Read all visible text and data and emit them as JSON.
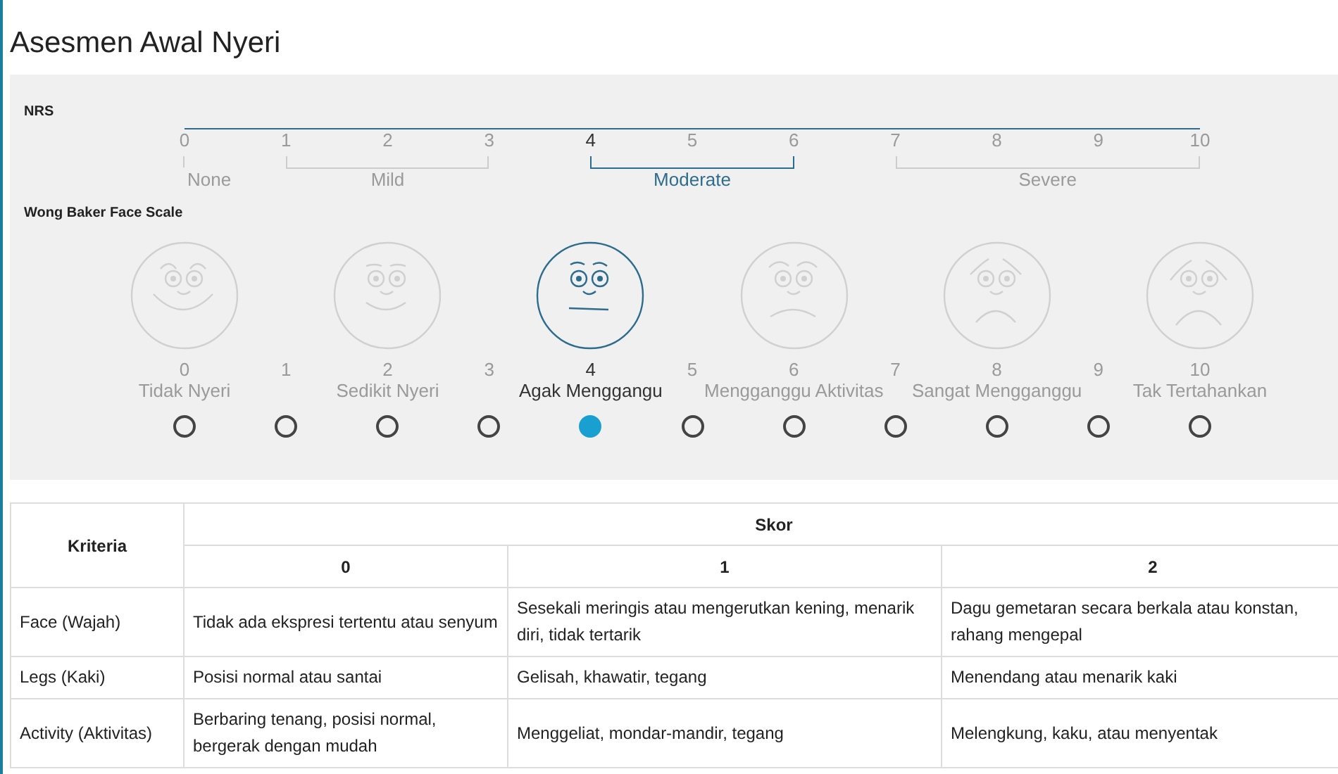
{
  "title": "Asesmen Awal Nyeri",
  "nrs": {
    "label": "NRS",
    "numbers": [
      {
        "label": "0",
        "selected": false
      },
      {
        "label": "1",
        "selected": false
      },
      {
        "label": "2",
        "selected": false
      },
      {
        "label": "3",
        "selected": false
      },
      {
        "label": "4",
        "selected": true
      },
      {
        "label": "5",
        "selected": false
      },
      {
        "label": "6",
        "selected": false
      },
      {
        "label": "7",
        "selected": false
      },
      {
        "label": "8",
        "selected": false
      },
      {
        "label": "9",
        "selected": false
      },
      {
        "label": "10",
        "selected": false
      }
    ],
    "categories": [
      {
        "label": "None",
        "selected": false
      },
      {
        "label": "Mild",
        "selected": false
      },
      {
        "label": "Moderate",
        "selected": true
      },
      {
        "label": "Severe",
        "selected": false
      }
    ]
  },
  "wong_baker": {
    "label": "Wong Baker Face Scale",
    "options": [
      {
        "kind": "face",
        "number": "0",
        "label": "Tidak Nyeri",
        "selected": false
      },
      {
        "kind": "plain",
        "number": "1",
        "selected": false
      },
      {
        "kind": "face",
        "number": "2",
        "label": "Sedikit Nyeri",
        "selected": false
      },
      {
        "kind": "plain",
        "number": "3",
        "selected": false
      },
      {
        "kind": "face",
        "number": "4",
        "label": "Agak Menggangu",
        "selected": true
      },
      {
        "kind": "plain",
        "number": "5",
        "selected": false
      },
      {
        "kind": "face",
        "number": "6",
        "label": "Mengganggu Aktivitas",
        "selected": false
      },
      {
        "kind": "plain",
        "number": "7",
        "selected": false
      },
      {
        "kind": "face",
        "number": "8",
        "label": "Sangat Mengganggu",
        "selected": false
      },
      {
        "kind": "plain",
        "number": "9",
        "selected": false
      },
      {
        "kind": "face",
        "number": "10",
        "label": "Tak Tertahankan",
        "selected": false
      }
    ]
  },
  "table": {
    "criteria_header": "Kriteria",
    "score_header": "Skor",
    "score_columns": [
      "0",
      "1",
      "2"
    ],
    "rows": [
      {
        "criteria": "Face (Wajah)",
        "cells": [
          "Tidak ada ekspresi tertentu atau senyum",
          "Sesekali meringis atau mengerutkan kening, menarik diri, tidak tertarik",
          "Dagu gemetaran secara berkala atau konstan, rahang mengepal"
        ]
      },
      {
        "criteria": "Legs (Kaki)",
        "cells": [
          "Posisi normal atau santai",
          "Gelisah, khawatir, tegang",
          "Menendang atau menarik kaki"
        ]
      },
      {
        "criteria": "Activity (Aktivitas)",
        "cells": [
          "Berbaring tenang, posisi normal, bergerak dengan mudah",
          "Menggeliat, mondar-mandir, tegang",
          "Melengkung, kaku, atau menyentak"
        ]
      }
    ]
  }
}
